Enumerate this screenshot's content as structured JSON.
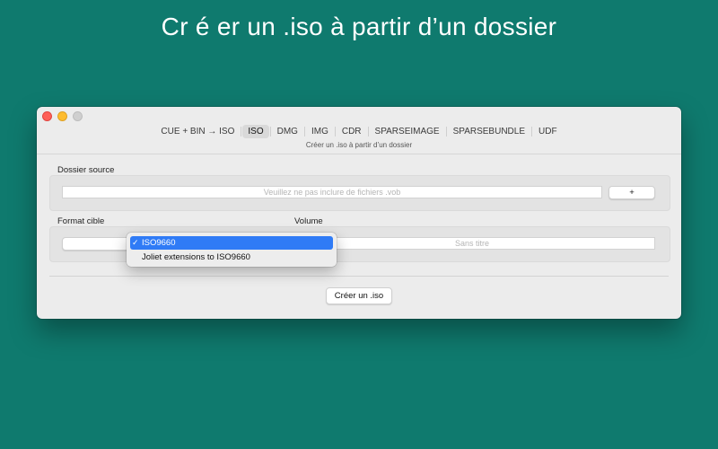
{
  "headline": "Cr é er un .iso  à  partir d’un dossier",
  "window": {
    "tabs": [
      {
        "label": "CUE + BIN → ISO",
        "active": false
      },
      {
        "label": "ISO",
        "active": true
      },
      {
        "label": "DMG",
        "active": false
      },
      {
        "label": "IMG",
        "active": false
      },
      {
        "label": "CDR",
        "active": false
      },
      {
        "label": "SPARSEIMAGE",
        "active": false
      },
      {
        "label": "SPARSEBUNDLE",
        "active": false
      },
      {
        "label": "UDF",
        "active": false
      }
    ],
    "subtitle": "Créer un .iso à partir d’un dossier",
    "source": {
      "label": "Dossier source",
      "placeholder": "Veuillez ne pas inclure de fichiers .vob",
      "add_label": "+"
    },
    "format": {
      "label": "Format cible",
      "selected": "ISO9660",
      "options": [
        "ISO9660",
        "Joliet extensions to ISO9660"
      ]
    },
    "volume": {
      "label": "Volume",
      "placeholder": "Sans titre"
    },
    "create_label": "Créer un .iso"
  },
  "colors": {
    "background": "#0f7a6e",
    "selection": "#2f7bf6"
  },
  "icons": [
    "close-icon",
    "minimize-icon",
    "zoom-icon",
    "checkmark-icon"
  ]
}
